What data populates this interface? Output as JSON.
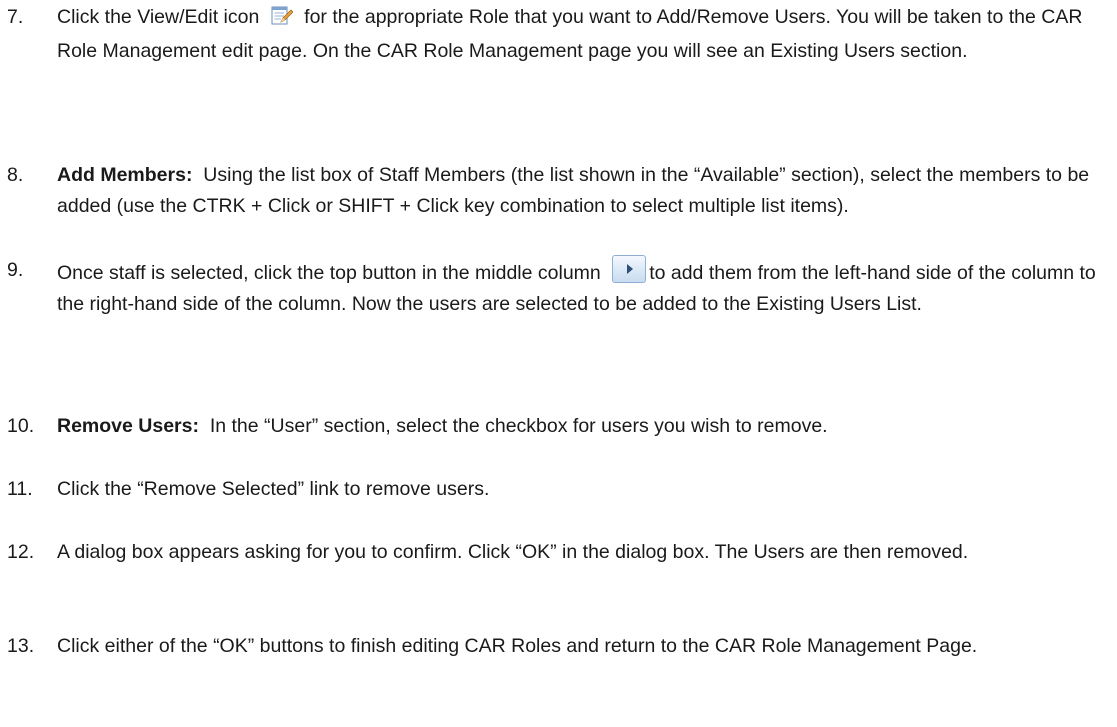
{
  "steps": [
    {
      "number": "7.",
      "text_before_icon": "Click the View/Edit icon",
      "icon": "view-edit-icon",
      "text_after_icon": "for the appropriate Role that you want to Add/Remove Users. You will be taken to the CAR Role Management edit page. On the CAR Role Management page you will see an Existing Users section."
    },
    {
      "number": "8.",
      "label": "Add Members:",
      "text": "Using the list box of Staff Members (the list shown in the “Available” section), select the members to be added (use the CTRK + Click or SHIFT + Click key combination to select multiple list items)."
    },
    {
      "number": "9.",
      "text_before_icon": "Once staff is selected, click the top button in the middle column",
      "icon": "move-right-button-icon",
      "text_after_icon": "to add them from the left-hand side of the column to the right-hand side of the column. Now the users are selected to be added to the Existing Users List."
    },
    {
      "number": "10.",
      "label": "Remove Users:",
      "text": "In the “User” section, select the checkbox for users you wish to remove."
    },
    {
      "number": "11.",
      "text": "Click the “Remove Selected” link to remove users."
    },
    {
      "number": "12.",
      "text": "A dialog box appears asking for you to confirm.  Click “OK” in the dialog box. The Users are then removed."
    },
    {
      "number": "13.",
      "text": "Click either of the “OK” buttons to finish editing CAR Roles and return to the CAR Role Management Page."
    }
  ]
}
